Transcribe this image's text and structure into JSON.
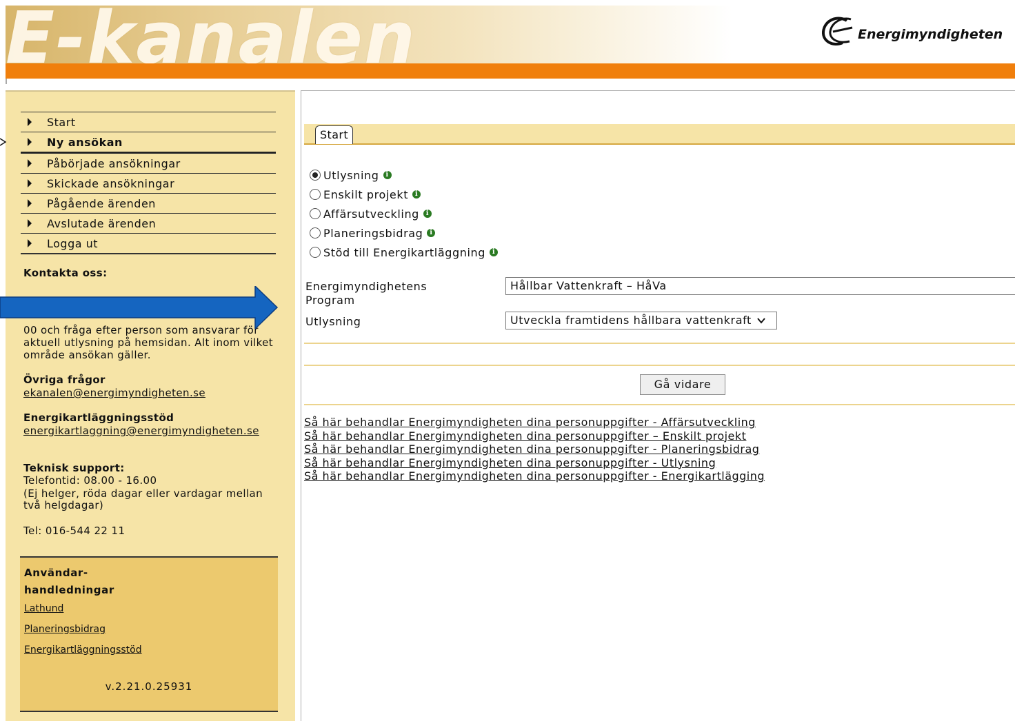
{
  "header": {
    "banner_title": "E-kanalen",
    "logo_text": "Energimyndigheten"
  },
  "sidebar": {
    "nav": [
      {
        "label": "Start",
        "active": false
      },
      {
        "label": "Ny ansökan",
        "active": true
      },
      {
        "label": "Påbörjade ansökningar",
        "active": false
      },
      {
        "label": "Skickade ansökningar",
        "active": false
      },
      {
        "label": "Pågående ärenden",
        "active": false
      },
      {
        "label": "Avslutade ärenden",
        "active": false
      },
      {
        "label": "Logga ut",
        "active": false
      }
    ],
    "contact_title": "Kontakta oss:",
    "contact_line1": "00 och fråga efter person som ansvarar för",
    "contact_line2": "aktuell utlysning på hemsidan. Alt inom vilket",
    "contact_line3": "område ansökan gäller.",
    "other_title": "Övriga frågor",
    "other_email": "ekanalen@energimyndigheten.se",
    "ek_title": "Energikartläggningsstöd",
    "ek_email": "energikartlaggning@energimyndigheten.se",
    "support_title": "Teknisk support:",
    "support_hours": "Telefontid: 08.00 - 16.00",
    "support_note1": "(Ej helger, röda dagar eller vardagar mellan",
    "support_note2": "två helgdagar)",
    "support_phone": "Tel: 016-544 22 11",
    "guides": {
      "title_line1": "Användar-",
      "title_line2": "handledningar",
      "links": [
        "Lathund",
        "Planeringsbidrag",
        "Energikartläggningsstöd"
      ],
      "version": "v.2.21.0.25931"
    }
  },
  "main": {
    "tab": "Start",
    "radios": [
      {
        "label": "Utlysning",
        "checked": true
      },
      {
        "label": "Enskilt projekt",
        "checked": false
      },
      {
        "label": "Affärsutveckling",
        "checked": false
      },
      {
        "label": "Planeringsbidrag",
        "checked": false
      },
      {
        "label": "Stöd till Energikartläggning",
        "checked": false
      }
    ],
    "program_label_1": "Energimyndighetens",
    "program_label_2": "Program",
    "program_value": "Hållbar Vattenkraft – HåVa",
    "utlysning_label": "Utlysning",
    "utlysning_value": "Utveckla framtidens hållbara vattenkraft",
    "continue_button": "Gå vidare",
    "privacy_links": [
      "Så här behandlar Energimyndigheten dina personuppgifter - Affärsutveckling",
      "Så här behandlar Energimyndigheten dina personuppgifter – Enskilt projekt",
      "Så här behandlar Energimyndigheten dina personuppgifter - Planeringsbidrag",
      "Så här behandlar Energimyndigheten dina personuppgifter - Utlysning",
      "Så här behandlar Energimyndigheten dina personuppgifter - Energikartlägging"
    ]
  },
  "colors": {
    "orange": "#f07f0c",
    "sidebar_bg": "#f6e4a7",
    "guides_bg": "#ecc96e",
    "info_green": "#2a7a22",
    "annotation_blue": "#1565c0"
  }
}
